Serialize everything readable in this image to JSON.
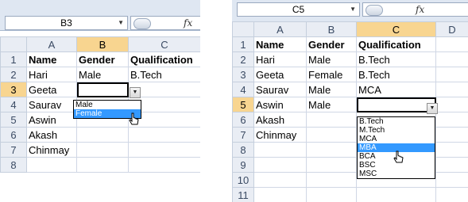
{
  "left": {
    "namebox": "B3",
    "fx": "fx",
    "columns": [
      "A",
      "B",
      "C"
    ],
    "rows": [
      {
        "num": "1",
        "cells": [
          "Name",
          "Gender",
          "Qualification"
        ]
      },
      {
        "num": "2",
        "cells": [
          "Hari",
          "Male",
          "B.Tech"
        ]
      },
      {
        "num": "3",
        "cells": [
          "Geeta",
          "",
          ""
        ]
      },
      {
        "num": "4",
        "cells": [
          "Saurav",
          "",
          ""
        ]
      },
      {
        "num": "5",
        "cells": [
          "Aswin",
          "",
          ""
        ]
      },
      {
        "num": "6",
        "cells": [
          "Akash",
          "",
          ""
        ]
      },
      {
        "num": "7",
        "cells": [
          "Chinmay",
          "",
          ""
        ]
      },
      {
        "num": "8",
        "cells": [
          "",
          "",
          ""
        ]
      }
    ],
    "dropdown_options": [
      "Male",
      "Female"
    ],
    "highlighted_option": "Female"
  },
  "right": {
    "namebox": "C5",
    "fx": "fx",
    "columns": [
      "A",
      "B",
      "C",
      "D"
    ],
    "rows": [
      {
        "num": "1",
        "cells": [
          "Name",
          "Gender",
          "Qualification",
          ""
        ]
      },
      {
        "num": "2",
        "cells": [
          "Hari",
          "Male",
          "B.Tech",
          ""
        ]
      },
      {
        "num": "3",
        "cells": [
          "Geeta",
          "Female",
          "B.Tech",
          ""
        ]
      },
      {
        "num": "4",
        "cells": [
          "Saurav",
          "Male",
          "MCA",
          ""
        ]
      },
      {
        "num": "5",
        "cells": [
          "Aswin",
          "Male",
          "",
          ""
        ]
      },
      {
        "num": "6",
        "cells": [
          "Akash",
          "",
          "",
          ""
        ]
      },
      {
        "num": "7",
        "cells": [
          "Chinmay",
          "",
          "",
          ""
        ]
      },
      {
        "num": "8",
        "cells": [
          "",
          "",
          "",
          ""
        ]
      },
      {
        "num": "9",
        "cells": [
          "",
          "",
          "",
          ""
        ]
      },
      {
        "num": "10",
        "cells": [
          "",
          "",
          "",
          ""
        ]
      },
      {
        "num": "11",
        "cells": [
          "",
          "",
          "",
          ""
        ]
      }
    ],
    "dropdown_options": [
      "B.Tech",
      "M.Tech",
      "MCA",
      "MBA",
      "BCA",
      "BSC",
      "MSC"
    ],
    "highlighted_option": "MBA"
  },
  "colors": {
    "selected_header": "#f8d590",
    "highlight": "#3399ff",
    "formula_bar": "#dfe7f2"
  }
}
